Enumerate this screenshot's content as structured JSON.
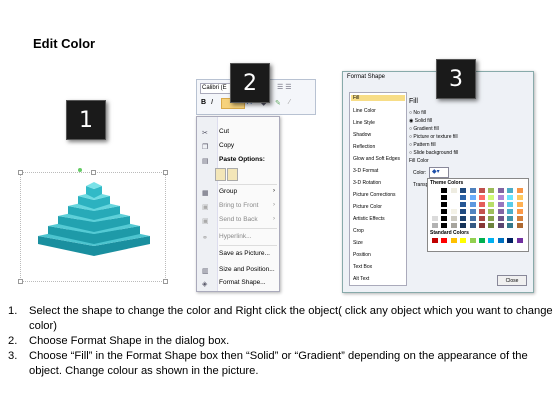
{
  "title": "Edit Color",
  "badges": [
    "1",
    "2",
    "3"
  ],
  "mini_toolbar": {
    "font": "Calibri (E",
    "bold": "B",
    "italic": "I"
  },
  "context_menu": {
    "items": [
      {
        "label": "Cut",
        "icon": "scissors-icon",
        "dim": false
      },
      {
        "label": "Copy",
        "icon": "copy-icon",
        "dim": false
      },
      {
        "label": "Paste Options:",
        "icon": "paste-icon",
        "dim": false
      },
      {
        "label": "Group",
        "icon": "group-icon",
        "dim": false
      },
      {
        "label": "Bring to Front",
        "icon": "bring-front-icon",
        "dim": true
      },
      {
        "label": "Send to Back",
        "icon": "send-back-icon",
        "dim": true
      },
      {
        "label": "Hyperlink...",
        "icon": "hyperlink-icon",
        "dim": true
      },
      {
        "label": "Save as Picture...",
        "icon": "save-picture-icon",
        "dim": false
      },
      {
        "label": "Size and Position...",
        "icon": "size-icon",
        "dim": false
      },
      {
        "label": "Format Shape...",
        "icon": "format-shape-icon",
        "dim": false
      }
    ]
  },
  "dialog": {
    "title": "Format Shape",
    "nav": [
      "Fill",
      "Line Color",
      "Line Style",
      "Shadow",
      "Reflection",
      "Glow and Soft Edges",
      "3-D Format",
      "3-D Rotation",
      "Picture Corrections",
      "Picture Color",
      "Artistic Effects",
      "Crop",
      "Size",
      "Position",
      "Text Box",
      "Alt Text"
    ],
    "section": "Fill",
    "options": [
      "No fill",
      "Solid fill",
      "Gradient fill",
      "Picture or texture fill",
      "Pattern fill",
      "Slide background fill"
    ],
    "fill_color": "Fill Color",
    "color_label": "Color:",
    "transparency_label": "Transpa",
    "theme_colors": "Theme Colors",
    "standard_colors": "Standard Colors",
    "close": "Close"
  },
  "steps": [
    {
      "num": "1.",
      "text": "Select the shape to change the color and Right click the object( click any object which you want to change color)"
    },
    {
      "num": "2.",
      "text": "Choose Format Shape in the dialog box."
    },
    {
      "num": "3.",
      "text": "Choose “Fill” in the Format Shape box then “Solid” or “Gradient” depending on the appearance of the object. Change colour as shown in the picture."
    }
  ]
}
